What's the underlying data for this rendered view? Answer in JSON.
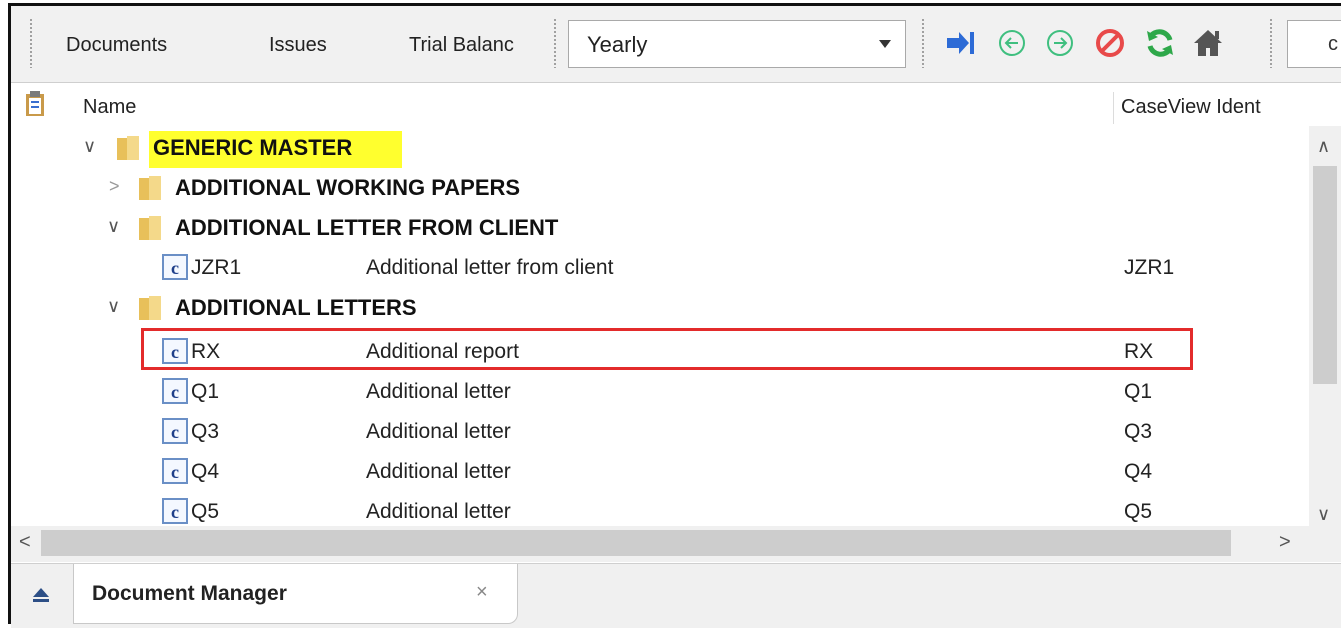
{
  "toolbar": {
    "tabs": [
      "Documents",
      "Issues",
      "Trial Balanc"
    ],
    "period_select": "Yearly",
    "search_value": "c",
    "colors": {
      "nav_blue": "#2d6bd6",
      "nav_green": "#3fbf7f",
      "stop_red": "#e84a4a",
      "refresh_green": "#2ea84a",
      "home_gray": "#555555"
    }
  },
  "columns": {
    "name": "Name",
    "ident": "CaseView Ident"
  },
  "tree": {
    "root": "GENERIC MASTER",
    "folders": [
      {
        "label": "ADDITIONAL WORKING PAPERS",
        "expanded": false
      },
      {
        "label": "ADDITIONAL LETTER FROM CLIENT",
        "expanded": true
      },
      {
        "label": "ADDITIONAL LETTERS",
        "expanded": true
      }
    ],
    "documents": [
      {
        "name": "JZR1",
        "desc": "Additional letter from client",
        "ident": "JZR1"
      },
      {
        "name": "RX",
        "desc": "Additional report",
        "ident": "RX"
      },
      {
        "name": "Q1",
        "desc": "Additional letter",
        "ident": "Q1"
      },
      {
        "name": "Q3",
        "desc": "Additional letter",
        "ident": "Q3"
      },
      {
        "name": "Q4",
        "desc": "Additional letter",
        "ident": "Q4"
      },
      {
        "name": "Q5",
        "desc": "Additional letter",
        "ident": "Q5"
      }
    ]
  },
  "bottom_tab": {
    "label": "Document Manager",
    "close": "×"
  },
  "highlight_color": "#ffff2e",
  "annotation_color": "#e32b2b"
}
